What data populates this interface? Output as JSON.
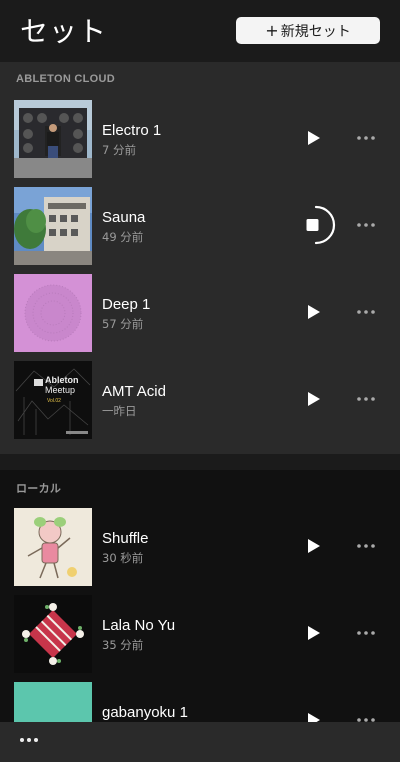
{
  "header": {
    "title": "セット",
    "new_set_label": "新規セット"
  },
  "sections": [
    {
      "label": "ABLETON CLOUD",
      "items": [
        {
          "name": "Electro 1",
          "time": "7 分前",
          "state": "stopped",
          "thumb_icon": "sound-system-photo-thumbnail"
        },
        {
          "name": "Sauna",
          "time": "49 分前",
          "state": "playing",
          "thumb_icon": "building-photo-thumbnail"
        },
        {
          "name": "Deep 1",
          "time": "57 分前",
          "state": "stopped",
          "thumb_icon": "pink-circle-thumbnail"
        },
        {
          "name": "AMT Acid",
          "time": "一昨日",
          "state": "stopped",
          "thumb_icon": "meetup-flyer-thumbnail",
          "thumb_text": {
            "line1": "Ableton",
            "line2": "Meetup",
            "line3": "Vol.02"
          }
        }
      ]
    },
    {
      "label": "ローカル",
      "items": [
        {
          "name": "Shuffle",
          "time": "30 秒前",
          "state": "stopped",
          "thumb_icon": "character-drawing-thumbnail"
        },
        {
          "name": "Lala No Yu",
          "time": "35 分前",
          "state": "stopped",
          "thumb_icon": "floral-pattern-thumbnail"
        },
        {
          "name": "gabanyoku 1",
          "time": "",
          "state": "stopped",
          "thumb_icon": "teal-thumbnail"
        }
      ]
    }
  ],
  "colors": {
    "background": "#1b1b1b",
    "cloud_section": "#2a2a2a",
    "local_section": "#111111",
    "accent_button": "#f4f4f4"
  }
}
